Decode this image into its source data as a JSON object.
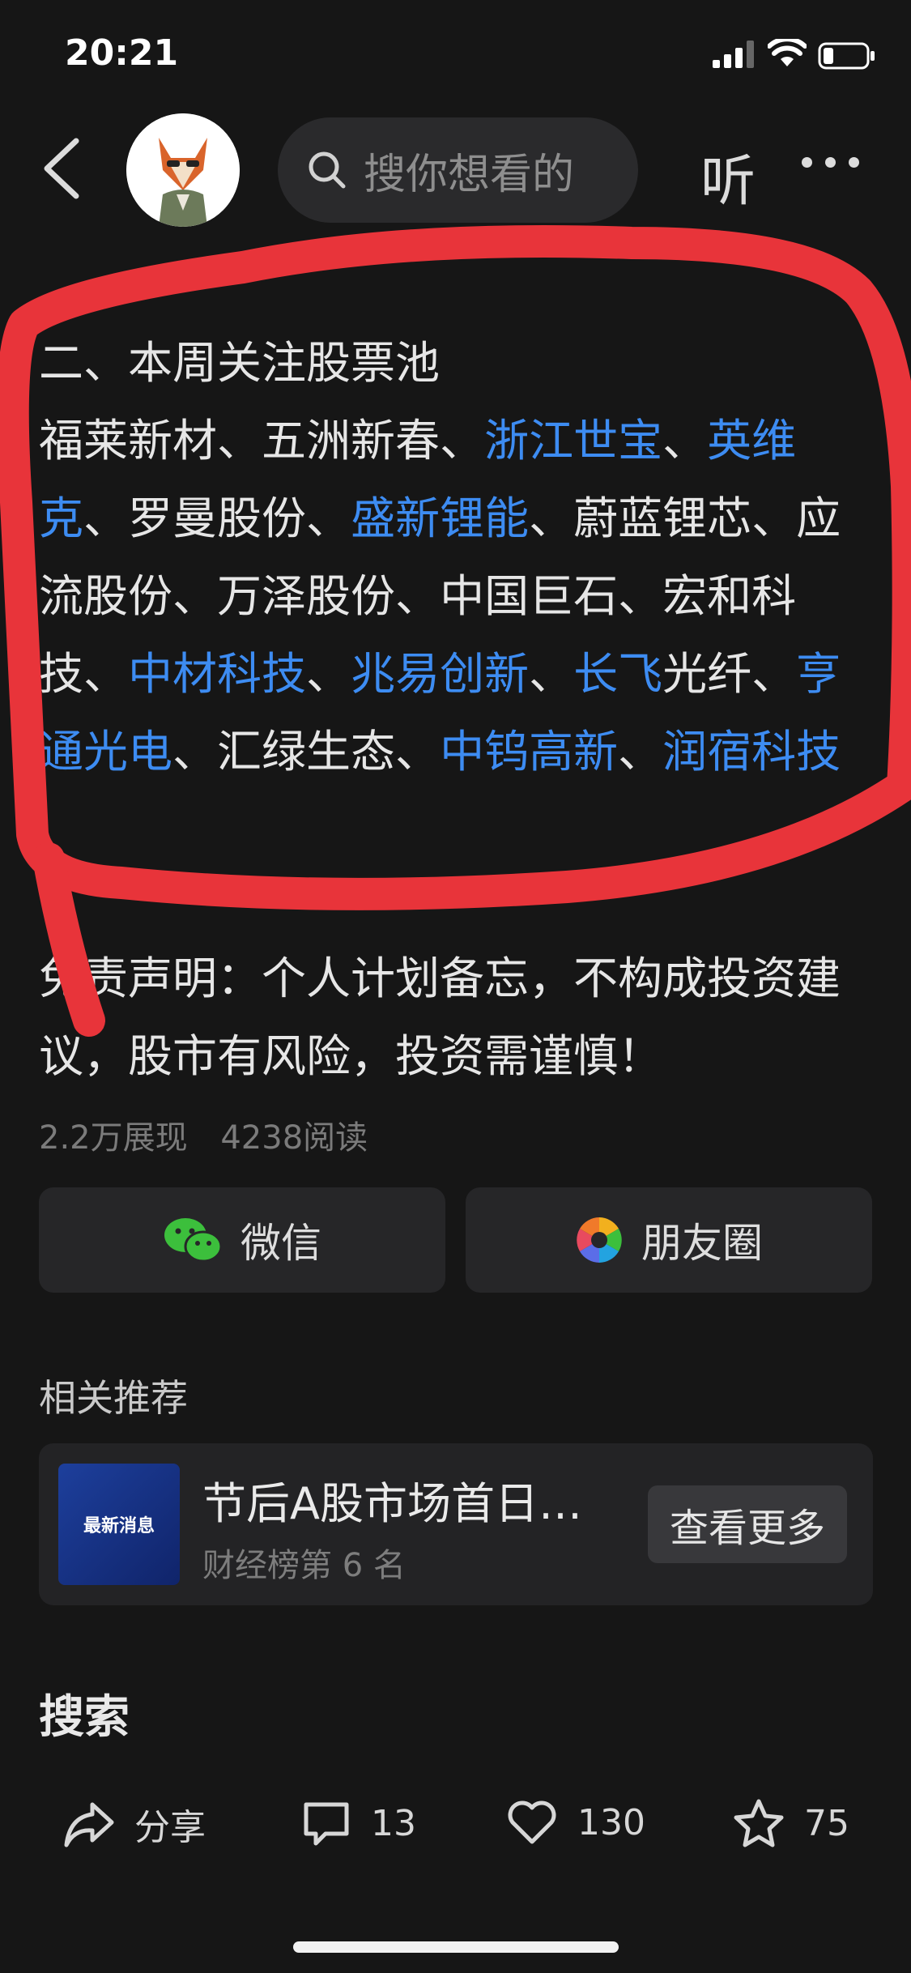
{
  "status_bar": {
    "time": "20:21",
    "battery_level": 0.2
  },
  "header": {
    "search_placeholder": "搜你想看的",
    "listen_label": "听"
  },
  "article": {
    "heading": "二、本周关注股票池",
    "stock_list": [
      {
        "name": "福莱新材",
        "link": false
      },
      {
        "name": "五洲新春",
        "link": false
      },
      {
        "name": "浙江世宝",
        "link": true
      },
      {
        "name": "英维克",
        "link": true
      },
      {
        "name": "罗曼股份",
        "link": false
      },
      {
        "name": "盛新锂能",
        "link": true
      },
      {
        "name": "蔚蓝锂芯",
        "link": false
      },
      {
        "name": "应流股份",
        "link": false
      },
      {
        "name": "万泽股份",
        "link": false
      },
      {
        "name": "中国巨石",
        "link": false
      },
      {
        "name": "宏和科技",
        "link": false
      },
      {
        "name": "中材科技",
        "link": true
      },
      {
        "name": "兆易创新",
        "link": true
      },
      {
        "name": "长飞",
        "link": true,
        "suffix": "光纤"
      },
      {
        "name": "亨通光电",
        "link": true
      },
      {
        "name": "汇绿生态",
        "link": false
      },
      {
        "name": "中钨高新",
        "link": true
      },
      {
        "name": "润宿科技",
        "link": true
      }
    ],
    "separator": "、",
    "disclaimer": "免责声明：个人计划备忘，不构成投资建议，股市有风险，投资需谨慎！",
    "stats": {
      "impressions": "2.2万展现",
      "reads": "4238阅读"
    }
  },
  "share": {
    "wechat": "微信",
    "moments": "朋友圈"
  },
  "related": {
    "title": "相关推荐",
    "card": {
      "thumb_text": "最新消息",
      "title": "节后A股市场首日…",
      "subtitle": "财经榜第 6 名",
      "button": "查看更多"
    }
  },
  "search_heading": "搜索",
  "bottom_bar": {
    "share": "分享",
    "comments": "13",
    "likes": "130",
    "favorites": "75"
  },
  "colors": {
    "link": "#3d8cf2",
    "scribble": "#e8343a",
    "background": "#161616"
  }
}
